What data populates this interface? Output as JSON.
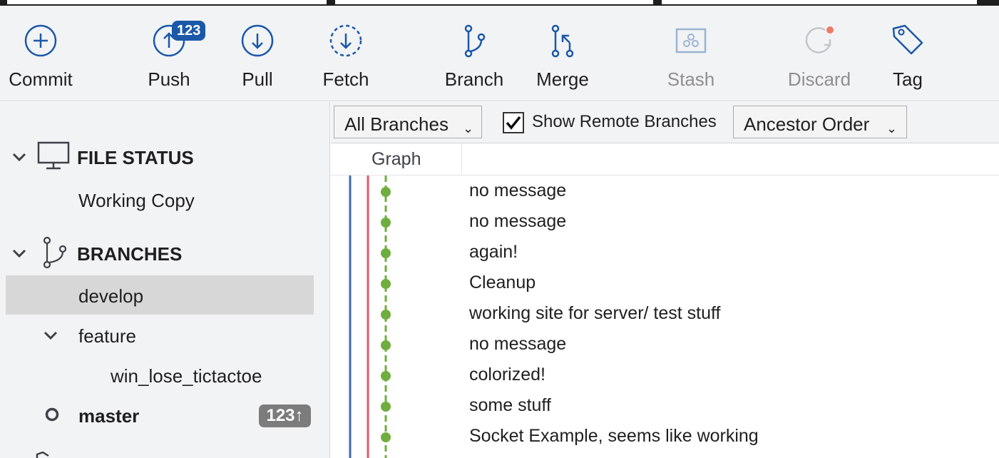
{
  "toolbar": {
    "buttons": [
      {
        "label": "Commit",
        "icon": "plus-circle-icon"
      },
      {
        "label": "Push",
        "icon": "arrow-up-circle-icon"
      },
      {
        "label": "Pull",
        "icon": "arrow-down-circle-icon"
      },
      {
        "label": "Fetch",
        "icon": "dashed-arrow-down-circle-icon"
      },
      {
        "label": "Branch",
        "icon": "branch-icon"
      },
      {
        "label": "Merge",
        "icon": "merge-icon"
      },
      {
        "label": "Stash",
        "icon": "stash-icon"
      },
      {
        "label": "Discard",
        "icon": "discard-icon"
      },
      {
        "label": "Tag",
        "icon": "tag-icon"
      }
    ],
    "push_badge": "123"
  },
  "sidebar": {
    "file_status_header": "FILE STATUS",
    "working_copy": "Working Copy",
    "branches_header": "BRANCHES",
    "branches": [
      {
        "label": "develop",
        "selected": true
      },
      {
        "label": "feature",
        "expanded": true
      },
      {
        "label": "win_lose_tictactoe"
      },
      {
        "label": "master",
        "current": true,
        "badge": "123↑"
      }
    ]
  },
  "filter": {
    "branches_dropdown": "All Branches",
    "show_remote_label": "Show Remote Branches",
    "show_remote_checked": true,
    "order_dropdown": "Ancestor Order"
  },
  "list": {
    "column_graph": "Graph",
    "commits": [
      "no message",
      "no message",
      "again!",
      "Cleanup",
      "working site for server/ test stuff",
      "no message",
      "colorized!",
      "some stuff",
      "Socket Example, seems like working"
    ]
  },
  "colors": {
    "accent": "#1b58a8",
    "lane_blue": "#3e6cac",
    "lane_red": "#e8566c",
    "lane_green": "#6fae3e"
  }
}
